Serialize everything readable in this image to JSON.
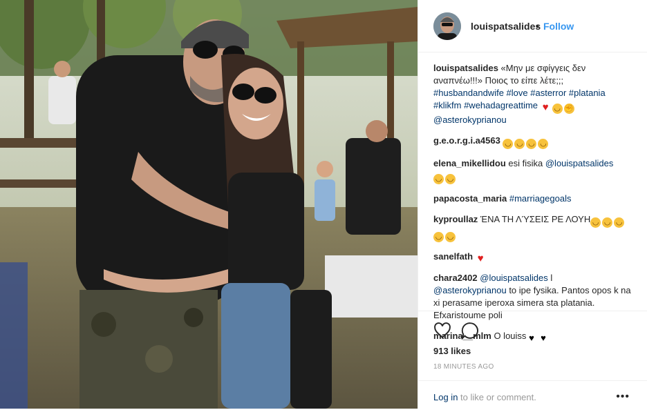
{
  "header": {
    "username": "louispatsalides",
    "separator": "•",
    "follow_label": "Follow"
  },
  "caption": {
    "username": "louispatsalides",
    "text": "«Μην με σφίγγεις δεν αναπνέω!!!» Ποιος το είπε λέτε;;;",
    "hashtags": [
      "#husbandandwife",
      "#love",
      "#asterror",
      "#platania",
      "#klikfm",
      "#wehadagreattime"
    ],
    "mention": "@asterokyprianou",
    "emoji": [
      "red-heart",
      "smiling-face-with-sunglasses",
      "flexed-biceps"
    ]
  },
  "comments": [
    {
      "username": "g.e.o.r.g.i.a4563",
      "text": "",
      "emoji": [
        "grinning-squinting-face",
        "grinning-squinting-face",
        "grinning-squinting-face",
        "grinning-squinting-face"
      ]
    },
    {
      "username": "elena_mikellidou",
      "text": "esi fisika ",
      "mention": "@louispatsalides",
      "emoji": [
        "hugging-face",
        "hugging-face"
      ]
    },
    {
      "username": "papacosta_maria",
      "text": "",
      "hashtag": "#marriagegoals",
      "emoji": []
    },
    {
      "username": "kyproullaz",
      "text": "ΈΝΑ ΤΗ ΛΎΣΕΙΣ ΡΕ ΛΟΥΗ",
      "emoji": [
        "grinning-squinting-face",
        "grinning-squinting-face",
        "grinning-squinting-face",
        "grinning-squinting-face",
        "rolling-on-the-floor-laughing"
      ]
    },
    {
      "username": "sanelfath",
      "text": "",
      "emoji": [
        "red-heart"
      ]
    },
    {
      "username": "chara2402",
      "mention1": "@louispatsalides",
      "sep": " l ",
      "mention2": "@asterokyprianou",
      "text": " to ipe fysika. Pantos opos k na xi perasame iperoxa simera sta platania. Efxaristoume poli"
    },
    {
      "username": "marina__mlm",
      "text": "O louiss",
      "emoji": [
        "black-heart",
        "black-heart"
      ]
    }
  ],
  "stats": {
    "likes": "913 likes",
    "time": "18 MINUTES AGO"
  },
  "footer": {
    "login_link": "Log in",
    "login_rest": " to like or comment.",
    "more_icon": "more-options-icon",
    "more_glyph": "•••"
  },
  "icons": {
    "like": "heart-outline-icon",
    "comment": "comment-bubble-icon"
  },
  "colors": {
    "link": "#3897f0",
    "tag": "#003569",
    "muted": "#999999",
    "heart": "#e02020"
  }
}
